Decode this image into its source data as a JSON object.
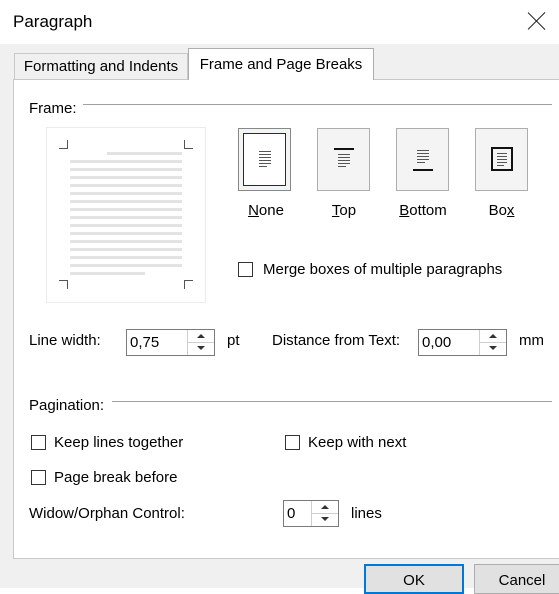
{
  "window": {
    "title": "Paragraph"
  },
  "tabs": [
    {
      "label": "Formatting and Indents",
      "active": false
    },
    {
      "label": "Frame and Page Breaks",
      "active": true
    }
  ],
  "frame": {
    "group_label": "Frame:",
    "buttons": [
      {
        "label": "None",
        "access_key": "N",
        "rest": "one",
        "icon": "frame-none-icon",
        "selected": true
      },
      {
        "label": "Top",
        "access_key": "T",
        "rest": "op",
        "icon": "frame-top-icon",
        "selected": false
      },
      {
        "label": "Bottom",
        "access_key": "B",
        "rest": "ottom",
        "icon": "frame-bottom-icon",
        "selected": false
      },
      {
        "label": "Box",
        "access_key": "x",
        "prefix": "Bo",
        "icon": "frame-box-icon",
        "selected": false
      }
    ],
    "merge_label": "Merge boxes of multiple paragraphs",
    "merge_checked": false,
    "line_width": {
      "label": "Line width:",
      "value": "0,75",
      "unit": "pt"
    },
    "distance": {
      "label": "Distance from Text:",
      "value": "0,00",
      "unit": "mm"
    }
  },
  "pagination": {
    "group_label": "Pagination:",
    "keep_lines_together": {
      "label": "Keep lines together",
      "checked": false
    },
    "keep_with_next": {
      "label": "Keep with next",
      "checked": false
    },
    "page_break_before": {
      "label": "Page break before",
      "checked": false
    },
    "widow_orphan": {
      "label": "Widow/Orphan Control:",
      "value": "0",
      "unit": "lines"
    }
  },
  "buttons": {
    "ok": "OK",
    "cancel": "Cancel"
  }
}
